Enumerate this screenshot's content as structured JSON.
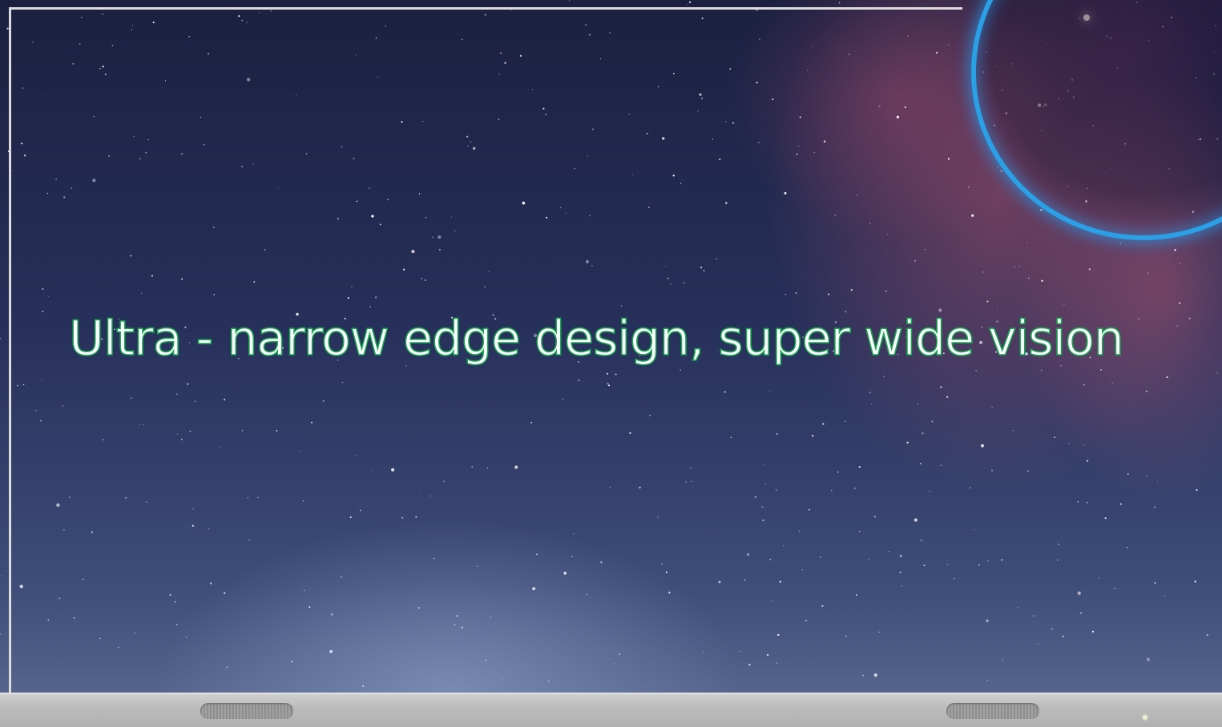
{
  "headline": "Ultra - narrow edge design, super wide vision",
  "colors": {
    "text_fill": "#ffffff",
    "text_outline": "#19a852",
    "ring": "#2aa0e6",
    "bezel": "#bcbcbc",
    "frame": "#dcdcdc"
  },
  "elements": {
    "background": "starry-night-sky",
    "ring": "glowing-blue-ring",
    "bezel": "display-bottom-bezel",
    "speakers": [
      "left-speaker-grille",
      "right-speaker-grille"
    ]
  }
}
